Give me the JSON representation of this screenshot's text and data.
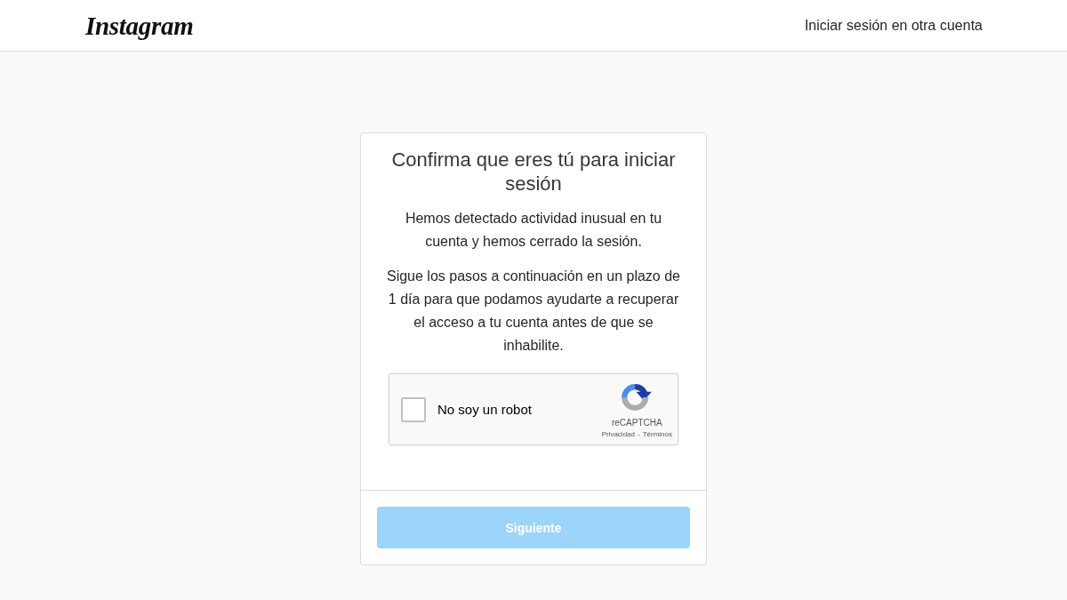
{
  "header": {
    "logo": "Instagram",
    "switch_account_link": "Iniciar sesión en otra cuenta"
  },
  "card": {
    "title": "Confirma que eres tú para iniciar sesión",
    "paragraphs": [
      "Hemos detectado actividad inusual en tu cuenta y hemos cerrado la sesión.",
      "Sigue los pasos a continuación en un plazo de 1 día para que podamos ayudarte a recuperar el acceso a tu cuenta antes de que se inhabilite."
    ],
    "captcha": {
      "label": "No soy un robot",
      "checked": false,
      "brand": "reCAPTCHA",
      "links": [
        "Privacidad",
        "Términos"
      ],
      "link_separator": "-"
    },
    "next_button": {
      "label": "Siguiente",
      "disabled": true
    }
  }
}
